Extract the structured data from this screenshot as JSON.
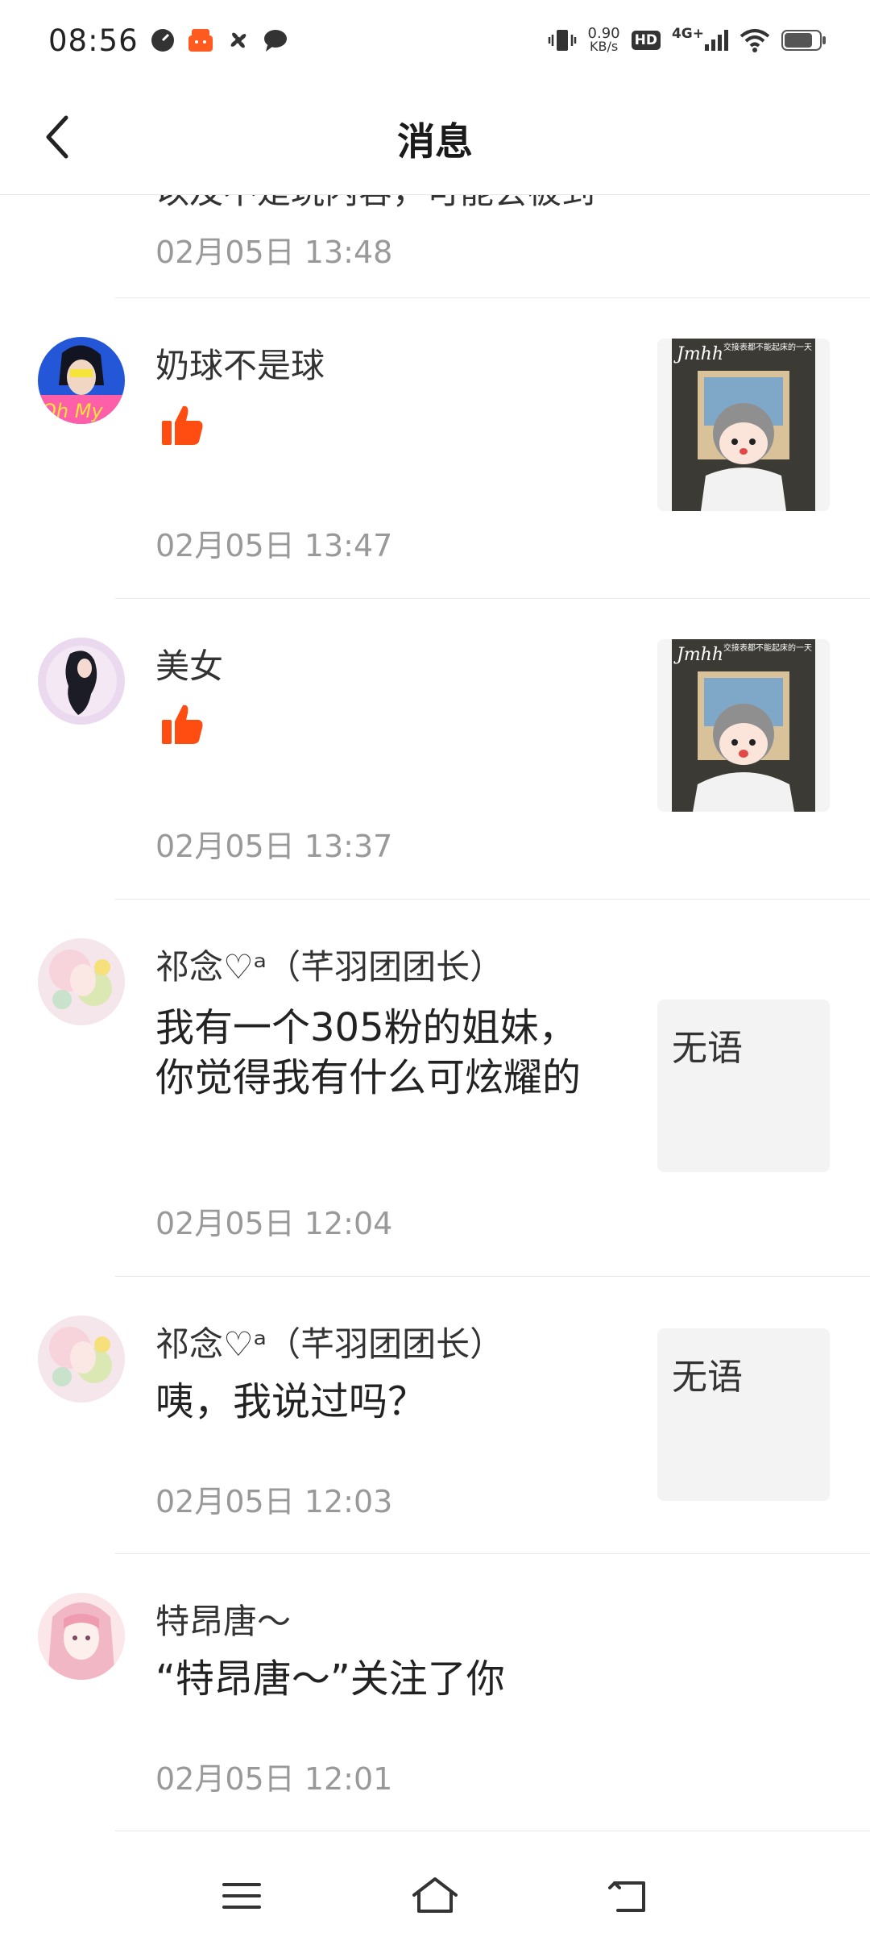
{
  "status_bar": {
    "time": "08:56",
    "net_speed_value": "0.90",
    "net_speed_unit": "KB/s",
    "hd_label": "HD",
    "network": "4G+"
  },
  "header": {
    "title": "消息"
  },
  "partial_item": {
    "text": "以及不是玩内容，可能会被到",
    "time": "02月05日 13:48"
  },
  "messages": [
    {
      "user": "奶球不是球",
      "type": "like",
      "time": "02月05日 13:47",
      "avatar_text": "Oh My"
    },
    {
      "user": "美女",
      "type": "like",
      "time": "02月05日 13:37"
    },
    {
      "user": "祁念♡ᵃ（芊羽团团长）",
      "type": "comment",
      "text": "我有一个305粉的姐妹，你觉得我有什么可炫耀的",
      "time": "02月05日 12:04",
      "thumb_text": "无语"
    },
    {
      "user": "祁念♡ᵃ（芊羽团团长）",
      "type": "comment",
      "text": "咦，我说过吗？",
      "time": "02月05日 12:03",
      "thumb_text": "无语"
    },
    {
      "user": "特昂唐～",
      "type": "follow",
      "text": "“特昂唐～”关注了你",
      "time": "02月05日 12:01"
    }
  ],
  "thumb_overlay": {
    "brand": "Jmhh",
    "caption": "交接表都不能起床的一天"
  },
  "colors": {
    "accent": "#ff4d12",
    "time_gray": "#999999",
    "divider": "#e8e8e8"
  }
}
